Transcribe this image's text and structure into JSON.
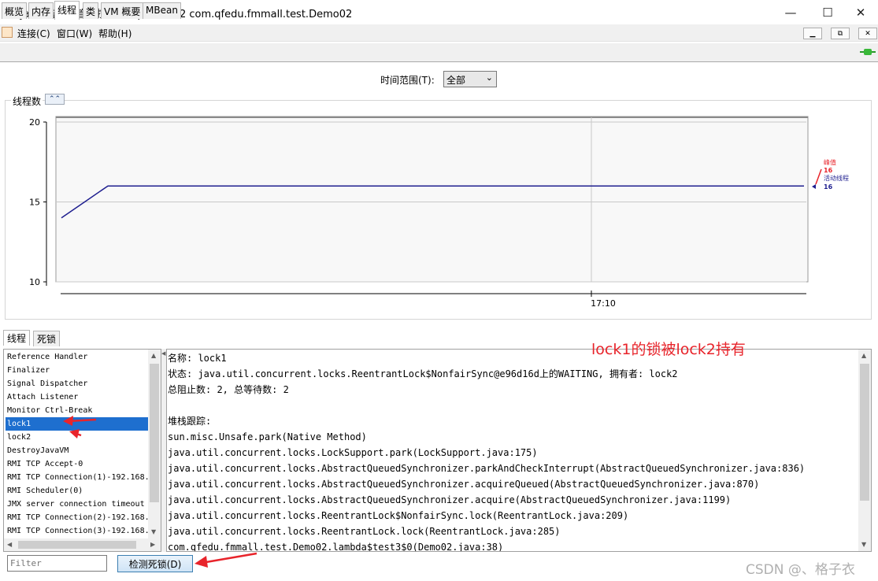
{
  "window": {
    "title": "Java 监视和管理控制台 - pid: 7872 com.qfedu.fmmall.test.Demo02",
    "minimize_icon": "minimize-icon",
    "maximize_icon": "maximize-icon",
    "close_icon": "close-icon"
  },
  "menu": [
    "连接(C)",
    "窗口(W)",
    "帮助(H)"
  ],
  "mdi_buttons": [
    "minimize-icon",
    "restore-icon",
    "close-icon"
  ],
  "tabs": [
    {
      "label": "概览",
      "active": false
    },
    {
      "label": "内存",
      "active": false
    },
    {
      "label": "线程",
      "active": true
    },
    {
      "label": "类",
      "active": false
    },
    {
      "label": "VM 概要",
      "active": false
    },
    {
      "label": "MBean",
      "active": false
    }
  ],
  "time_range": {
    "label": "时间范围(T):",
    "value": "全部"
  },
  "chart_panel": {
    "title": "线程数",
    "collapse_icon": "double-chevron-up-icon"
  },
  "chart_data": {
    "type": "line",
    "title": "线程数",
    "ylim": [
      10,
      20
    ],
    "yticks": [
      "20",
      "15",
      "10"
    ],
    "xticks": [
      "17:10"
    ],
    "series": [
      {
        "name": "峰值",
        "value": "16",
        "color": "#e8242b",
        "points": [
          16,
          16
        ]
      },
      {
        "name": "活动线程",
        "value": "16",
        "color": "#1f1f8f",
        "points": [
          14,
          16,
          16,
          16,
          16,
          16,
          16,
          16,
          16,
          16,
          16,
          16,
          16,
          16
        ]
      }
    ],
    "grid": true
  },
  "subtabs": [
    {
      "label": "线程",
      "active": true
    },
    {
      "label": "死锁",
      "active": false
    }
  ],
  "threads": [
    "Reference Handler",
    "Finalizer",
    "Signal Dispatcher",
    "Attach Listener",
    "Monitor Ctrl-Break",
    "lock1",
    "lock2",
    "DestroyJavaVM",
    "RMI TCP Accept-0",
    "RMI TCP Connection(1)-192.168.",
    "RMI Scheduler(0)",
    "JMX server connection timeout",
    "RMI TCP Connection(2)-192.168.",
    "RMI TCP Connection(3)-192.168."
  ],
  "selected_thread_index": 5,
  "detail": {
    "lines": [
      "名称: lock1",
      "状态: java.util.concurrent.locks.ReentrantLock$NonfairSync@e96d16d上的WAITING, 拥有者: lock2",
      "总阻止数: 2, 总等待数: 2",
      "",
      "堆栈跟踪:",
      "sun.misc.Unsafe.park(Native Method)",
      "java.util.concurrent.locks.LockSupport.park(LockSupport.java:175)",
      "java.util.concurrent.locks.AbstractQueuedSynchronizer.parkAndCheckInterrupt(AbstractQueuedSynchronizer.java:836)",
      "java.util.concurrent.locks.AbstractQueuedSynchronizer.acquireQueued(AbstractQueuedSynchronizer.java:870)",
      "java.util.concurrent.locks.AbstractQueuedSynchronizer.acquire(AbstractQueuedSynchronizer.java:1199)",
      "java.util.concurrent.locks.ReentrantLock$NonfairSync.lock(ReentrantLock.java:209)",
      "java.util.concurrent.locks.ReentrantLock.lock(ReentrantLock.java:285)",
      "com.qfedu.fmmall.test.Demo02.lambda$test3$0(Demo02.java:38)"
    ]
  },
  "filter": {
    "placeholder": "Filter",
    "value": ""
  },
  "detect_button": {
    "label": "检测死锁(D)"
  },
  "annotation": {
    "text": "lock1的锁被lock2持有",
    "color": "#e8242b"
  },
  "watermark": "CSDN @、格子衣"
}
